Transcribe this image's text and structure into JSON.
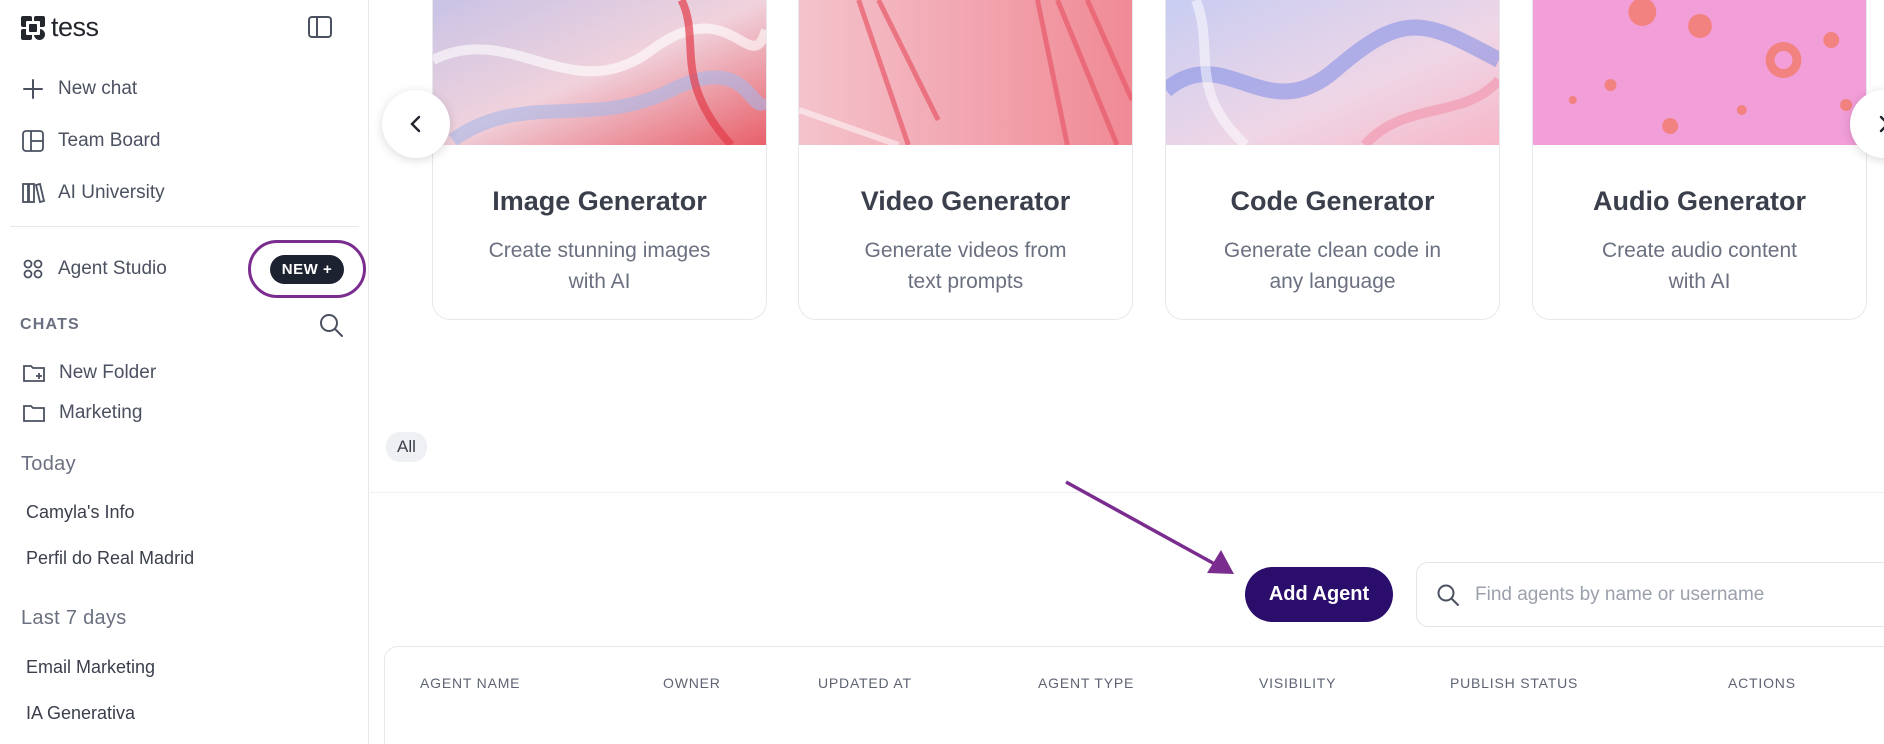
{
  "brand": {
    "name": "tess"
  },
  "sidebar": {
    "nav": [
      {
        "label": "New chat",
        "icon": "plus-icon"
      },
      {
        "label": "Team Board",
        "icon": "board-icon"
      },
      {
        "label": "AI University",
        "icon": "library-icon"
      }
    ],
    "agent_studio": {
      "label": "Agent Studio",
      "icon": "grid-icon",
      "badge": "NEW"
    },
    "chats_label": "CHATS",
    "folders": [
      {
        "label": "New Folder",
        "icon": "folder-plus-icon"
      },
      {
        "label": "Marketing",
        "icon": "folder-icon"
      }
    ],
    "groups": [
      {
        "title": "Today",
        "items": [
          "Camyla's Info",
          "Perfil do Real Madrid"
        ]
      },
      {
        "title": "Last 7 days",
        "items": [
          "Email Marketing",
          "IA Generativa"
        ]
      }
    ]
  },
  "cards": [
    {
      "title": "Image Generator",
      "desc_line1": "Create stunning images",
      "desc_line2": "with AI"
    },
    {
      "title": "Video Generator",
      "desc_line1": "Generate videos from",
      "desc_line2": "text prompts"
    },
    {
      "title": "Code Generator",
      "desc_line1": "Generate clean code in",
      "desc_line2": "any language"
    },
    {
      "title": "Audio Generator",
      "desc_line1": "Create audio content",
      "desc_line2": "with AI"
    }
  ],
  "filter": {
    "label": "All"
  },
  "actions": {
    "add_agent": "Add Agent",
    "search_placeholder": "Find agents by name or username"
  },
  "table": {
    "columns": [
      "AGENT NAME",
      "OWNER",
      "UPDATED AT",
      "AGENT TYPE",
      "VISIBILITY",
      "PUBLISH STATUS",
      "ACTIONS"
    ]
  },
  "colors": {
    "accent": "#2b0d6b",
    "annotation": "#7b2d8f",
    "badge_bg": "#1d2230"
  }
}
